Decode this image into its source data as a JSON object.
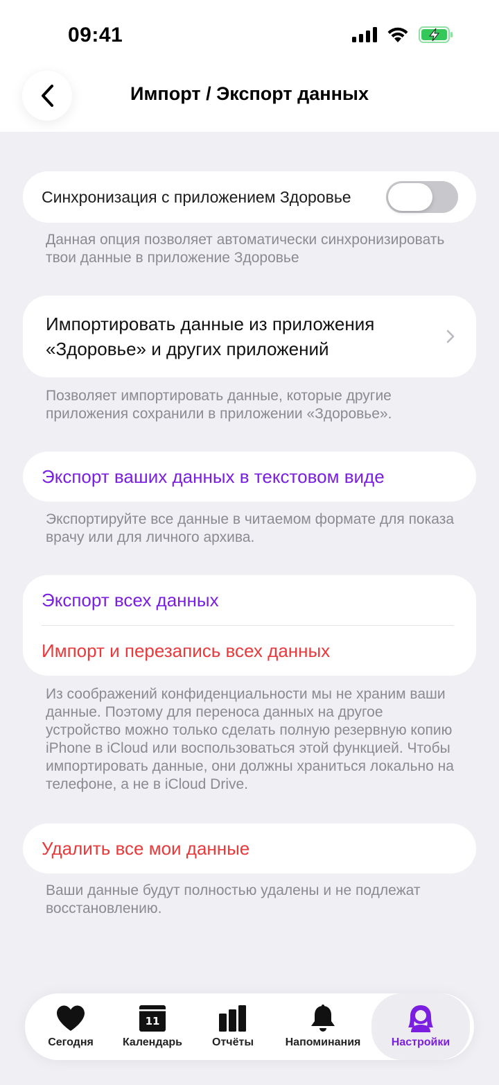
{
  "status": {
    "time": "09:41"
  },
  "header": {
    "title": "Импорт / Экспорт данных"
  },
  "sync": {
    "label": "Синхронизация с приложением Здоровье",
    "enabled": false,
    "note": "Данная опция позволяет автоматически синхронизировать твои данные в приложение Здоровье"
  },
  "import_health": {
    "label": "Импортировать данные из приложения «Здоровье» и других приложений",
    "note": "Позволяет импортировать данные, которые другие приложения сохранили в приложении «Здоровье»."
  },
  "export_text": {
    "label": "Экспорт ваших данных в текстовом виде",
    "note": "Экспортируйте все данные в читаемом формате для показа врачу или для личного архива."
  },
  "backup": {
    "export_label": "Экспорт всех данных",
    "import_label": "Импорт и перезапись всех данных",
    "note": "Из соображений конфиденциальности мы не храним ваши данные. Поэтому для переноса данных на другое устройство можно только сделать полную резервную копию iPhone в iCloud или воспользоваться этой функцией. Чтобы импортировать данные, они должны храниться локально на телефоне, а не в iCloud Drive."
  },
  "delete": {
    "label": "Удалить все мои данные",
    "note": "Ваши данные будут полностью удалены и не подлежат восстановлению."
  },
  "tabs": [
    {
      "label": "Сегодня",
      "icon": "heart-icon"
    },
    {
      "label": "Календарь",
      "icon": "calendar-icon",
      "badge": "11"
    },
    {
      "label": "Отчёты",
      "icon": "bar-chart-icon"
    },
    {
      "label": "Напоминания",
      "icon": "bell-icon"
    },
    {
      "label": "Настройки",
      "icon": "profile-icon",
      "active": true
    }
  ],
  "colors": {
    "accent": "#7a1fe0",
    "destructive": "#e8393b",
    "background": "#efeff4"
  }
}
